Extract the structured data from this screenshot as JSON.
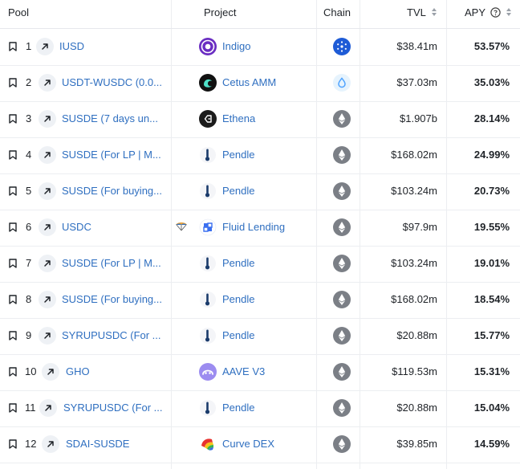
{
  "header": {
    "pool": "Pool",
    "project": "Project",
    "chain": "Chain",
    "tvl": "TVL",
    "apy": "APY"
  },
  "rows": [
    {
      "rank": "1",
      "pool": "IUSD",
      "project": "Indigo",
      "chain": "cardano",
      "tvl": "$38.41m",
      "apy": "53.57%"
    },
    {
      "rank": "2",
      "pool": "USDT-WUSDC (0.0...",
      "project": "Cetus AMM",
      "chain": "sui",
      "tvl": "$37.03m",
      "apy": "35.03%"
    },
    {
      "rank": "3",
      "pool": "SUSDE (7 days un...",
      "project": "Ethena",
      "chain": "ethereum",
      "tvl": "$1.907b",
      "apy": "28.14%"
    },
    {
      "rank": "4",
      "pool": "SUSDE (For LP | M...",
      "project": "Pendle",
      "chain": "ethereum",
      "tvl": "$168.02m",
      "apy": "24.99%"
    },
    {
      "rank": "5",
      "pool": "SUSDE (For buying...",
      "project": "Pendle",
      "chain": "ethereum",
      "tvl": "$103.24m",
      "apy": "20.73%"
    },
    {
      "rank": "6",
      "pool": "USDC",
      "project": "Fluid Lending",
      "chain": "ethereum",
      "tvl": "$97.9m",
      "apy": "19.55%"
    },
    {
      "rank": "7",
      "pool": "SUSDE (For LP | M...",
      "project": "Pendle",
      "chain": "ethereum",
      "tvl": "$103.24m",
      "apy": "19.01%"
    },
    {
      "rank": "8",
      "pool": "SUSDE (For buying...",
      "project": "Pendle",
      "chain": "ethereum",
      "tvl": "$168.02m",
      "apy": "18.54%"
    },
    {
      "rank": "9",
      "pool": "SYRUPUSDC (For ...",
      "project": "Pendle",
      "chain": "ethereum",
      "tvl": "$20.88m",
      "apy": "15.77%"
    },
    {
      "rank": "10",
      "pool": "GHO",
      "project": "AAVE V3",
      "chain": "ethereum",
      "tvl": "$119.53m",
      "apy": "15.31%"
    },
    {
      "rank": "11",
      "pool": "SYRUPUSDC (For ...",
      "project": "Pendle",
      "chain": "ethereum",
      "tvl": "$20.88m",
      "apy": "15.04%"
    },
    {
      "rank": "12",
      "pool": "SDAI-SUSDE",
      "project": "Curve DEX",
      "chain": "ethereum",
      "tvl": "$39.85m",
      "apy": "14.59%"
    }
  ],
  "colors": {
    "link": "#2f6fc0",
    "border": "#eceef1",
    "text": "#1f2328"
  }
}
